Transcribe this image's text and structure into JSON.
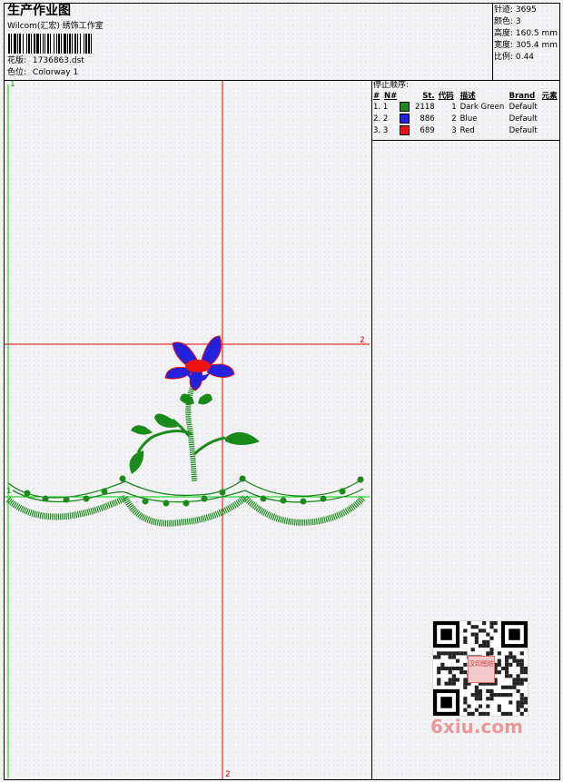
{
  "header": {
    "title": "生产作业图",
    "company": "Wilcom(汇宏) 绣饰工作室",
    "design_label": "花版:",
    "design_value": "1736863.dst",
    "colorway_label": "色位:",
    "colorway_value": "Colorway 1"
  },
  "stats": {
    "stitches": "针迹: 3695",
    "colors": "颜色: 3",
    "height": "高度: 160.5 mm",
    "width": "宽度: 305.4 mm",
    "scale": "比例: 0.44"
  },
  "stop_sequence": {
    "heading": "停止顺序:",
    "columns": [
      "#",
      "N#",
      "St.",
      "代码",
      "描述",
      "Brand",
      "元素"
    ],
    "rows": [
      {
        "idx": "1.",
        "n": "1",
        "color": "#1a8a1a",
        "stitches": "2118",
        "code": "1",
        "desc": "Dark Green",
        "brand": "Default"
      },
      {
        "idx": "2.",
        "n": "2",
        "color": "#2222dd",
        "stitches": "886",
        "code": "2",
        "desc": "Blue",
        "brand": "Default"
      },
      {
        "idx": "3.",
        "n": "3",
        "color": "#ee1111",
        "stitches": "689",
        "code": "3",
        "desc": "Red",
        "brand": "Default"
      }
    ]
  },
  "guides": {
    "h_label": "2",
    "v_label": "2",
    "left_top_label": "1",
    "left_mid_label": "1"
  },
  "colors": {
    "green": "#1a8a1a",
    "blue": "#2222dd",
    "red": "#ee1111",
    "guide_red": "#dd0000",
    "guide_green": "#00cc00"
  },
  "watermark": {
    "text": "6xiu.com",
    "stamp_text": "汉印图坊"
  }
}
